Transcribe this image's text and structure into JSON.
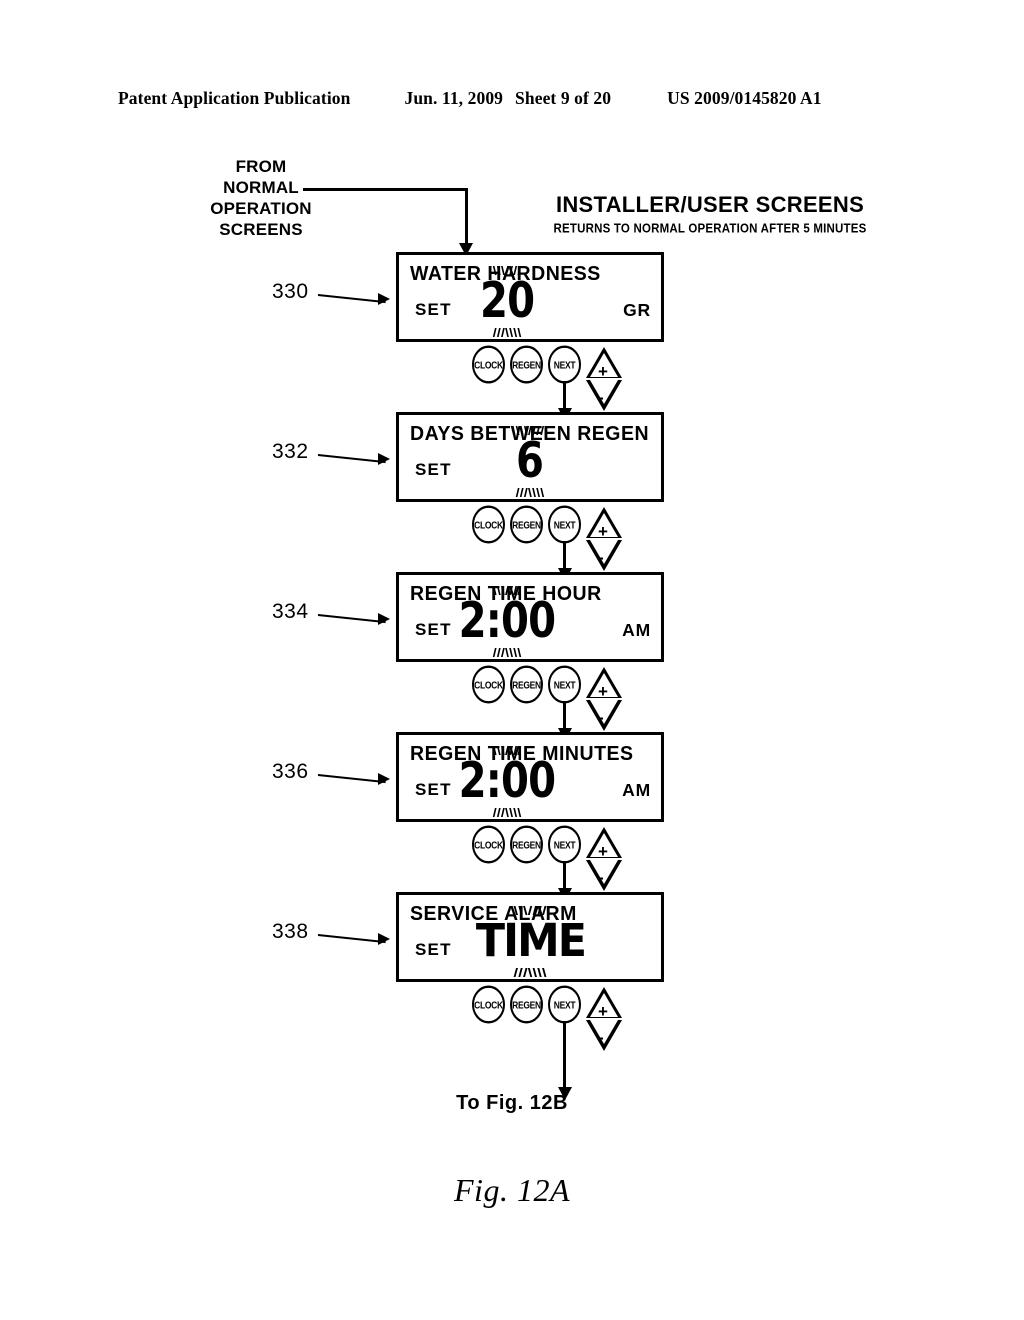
{
  "header": {
    "publication": "Patent Application Publication",
    "date": "Jun. 11, 2009",
    "sheet": "Sheet 9 of 20",
    "patent_number": "US 2009/0145820 A1"
  },
  "flow_start": {
    "line1": "FROM",
    "line2": "NORMAL",
    "line3": "OPERATION",
    "line4": "SCREENS"
  },
  "section_title": {
    "main": "INSTALLER/USER SCREENS",
    "sub": "RETURNS TO NORMAL OPERATION AFTER 5 MINUTES"
  },
  "buttons": {
    "clock": "CLOCK",
    "regen": "REGEN",
    "next": "NEXT",
    "increase": "+",
    "decrease": "-"
  },
  "steps": [
    {
      "ref": "330",
      "title": "WATER HARDNESS",
      "set_label": "SET",
      "value": "20",
      "unit": "GR",
      "flashing": true
    },
    {
      "ref": "332",
      "title": "DAYS BETWEEN REGEN",
      "set_label": "SET",
      "value": "6",
      "unit": "",
      "flashing": true
    },
    {
      "ref": "334",
      "title": "REGEN TIME HOUR",
      "set_label": "SET",
      "value": "2:00",
      "unit": "AM",
      "flashing": true
    },
    {
      "ref": "336",
      "title": "REGEN TIME MINUTES",
      "set_label": "SET",
      "value": "2:00",
      "unit": "AM",
      "flashing": true
    },
    {
      "ref": "338",
      "title": "SERVICE ALARM",
      "set_label": "SET",
      "value": "TIME",
      "unit": "",
      "flashing": true
    }
  ],
  "footer": {
    "to_fig": "To Fig. 12B",
    "caption": "Fig. 12A"
  }
}
